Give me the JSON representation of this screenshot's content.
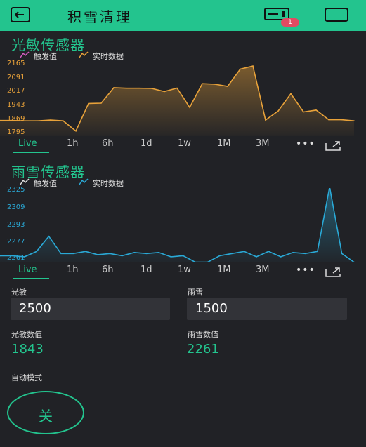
{
  "app": {
    "title": "积雪清理",
    "badge_count": "1"
  },
  "colors": {
    "accent": "#23c48e",
    "light_series": "#e8a23a",
    "snow_series": "#2aa9d6",
    "trigger_light": "#d45cc0",
    "background": "#212226"
  },
  "light_chart": {
    "title": "光敏传感器",
    "legend": {
      "trigger": "触发值",
      "realtime": "实时数据"
    },
    "y_ticks": [
      "2165",
      "2091",
      "2017",
      "1943",
      "1869",
      "1795"
    ],
    "tabs": [
      "Live",
      "1h",
      "6h",
      "1d",
      "1w",
      "1M",
      "3M"
    ],
    "more": "•••"
  },
  "snow_chart": {
    "title": "雨雪传感器",
    "legend": {
      "trigger": "触发值",
      "realtime": "实时数据"
    },
    "y_ticks": [
      "2325",
      "2309",
      "2293",
      "2277",
      "2261"
    ],
    "tabs": [
      "Live",
      "1h",
      "6h",
      "1d",
      "1w",
      "1M",
      "3M"
    ],
    "more": "•••"
  },
  "chart_data": [
    {
      "type": "area",
      "title": "光敏传感器",
      "series": [
        {
          "name": "触发值",
          "values": []
        },
        {
          "name": "实时数据",
          "values": [
            1858,
            1858,
            1856,
            1856,
            1860,
            1856,
            1800,
            1951,
            1953,
            2038,
            2035,
            2035,
            2034,
            2017,
            2036,
            1930,
            2060,
            2057,
            2045,
            2140,
            2157,
            1860,
            1910,
            2005,
            1905,
            1915,
            1862,
            1862,
            1856
          ]
        }
      ],
      "ylim": [
        1795,
        2165
      ]
    },
    {
      "type": "area",
      "title": "雨雪传感器",
      "series": [
        {
          "name": "触发值",
          "values": []
        },
        {
          "name": "实时数据",
          "values": [
            2264,
            2264,
            2263,
            2268,
            2282,
            2266,
            2266,
            2268,
            2265,
            2266,
            2264,
            2267,
            2266,
            2267,
            2263,
            2264,
            2258,
            2258,
            2264,
            2266,
            2268,
            2263,
            2268,
            2263,
            2267,
            2266,
            2268,
            2328,
            2266,
            2258
          ]
        }
      ],
      "ylim": [
        2261,
        2325
      ]
    }
  ],
  "controls": {
    "light_label": "光敏",
    "light_value": "2500",
    "snow_label": "雨雪",
    "snow_value": "1500",
    "light_reading_label": "光敏数值",
    "light_reading": "1843",
    "snow_reading_label": "雨雪数值",
    "snow_reading": "2261",
    "mode_label": "自动模式",
    "mode_button": "关"
  }
}
